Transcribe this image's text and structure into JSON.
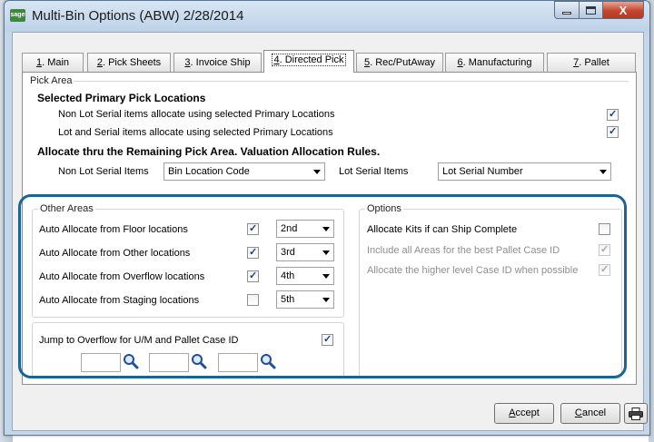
{
  "window": {
    "app_logo": "sage",
    "title": "Multi-Bin Options (ABW) 2/28/2014",
    "close_glyph": "X"
  },
  "tabs": [
    {
      "key": "1",
      "label": ". Main"
    },
    {
      "key": "2",
      "label": ". Pick Sheets"
    },
    {
      "key": "3",
      "label": ". Invoice Ship"
    },
    {
      "key": "4",
      "label": ". Directed Pick"
    },
    {
      "key": "5",
      "label": ". Rec/PutAway"
    },
    {
      "key": "6",
      "label": ". Manufacturing"
    },
    {
      "key": "7",
      "label": ". Pallet"
    }
  ],
  "pick_area": {
    "title": "Pick Area",
    "primary_heading": "Selected Primary Pick Locations",
    "non_lot_label": "Non Lot Serial items allocate using selected Primary Locations",
    "lot_label": "Lot and Serial items allocate using selected Primary Locations",
    "remaining_heading": "Allocate thru the Remaining Pick Area.  Valuation Allocation Rules.",
    "non_lot_items_label": "Non Lot Serial Items",
    "non_lot_items_value": "Bin Location Code",
    "lot_items_label": "Lot Serial Items",
    "lot_items_value": "Lot Serial Number"
  },
  "other_areas": {
    "title": "Other Areas",
    "rows": [
      {
        "label": "Auto Allocate from Floor locations",
        "checked": true,
        "order": "2nd"
      },
      {
        "label": "Auto Allocate from Other locations",
        "checked": true,
        "order": "3rd"
      },
      {
        "label": "Auto Allocate from Overflow locations",
        "checked": true,
        "order": "4th"
      },
      {
        "label": "Auto Allocate from Staging locations",
        "checked": false,
        "order": "5th"
      }
    ]
  },
  "jump": {
    "label": "Jump to Overflow for U/M and Pallet Case ID",
    "checked": true
  },
  "options": {
    "title": "Options",
    "kits_label": "Allocate Kits if can Ship Complete",
    "include_label": "Include all Areas for the best Pallet Case ID",
    "higher_label": "Allocate the higher level Case ID when possible"
  },
  "buttons": {
    "accept_key": "A",
    "accept_rest": "ccept",
    "cancel_key": "C",
    "cancel_rest": "ancel"
  },
  "colors": {
    "highlight": "#1a6496",
    "check": "#1c3f8a"
  }
}
